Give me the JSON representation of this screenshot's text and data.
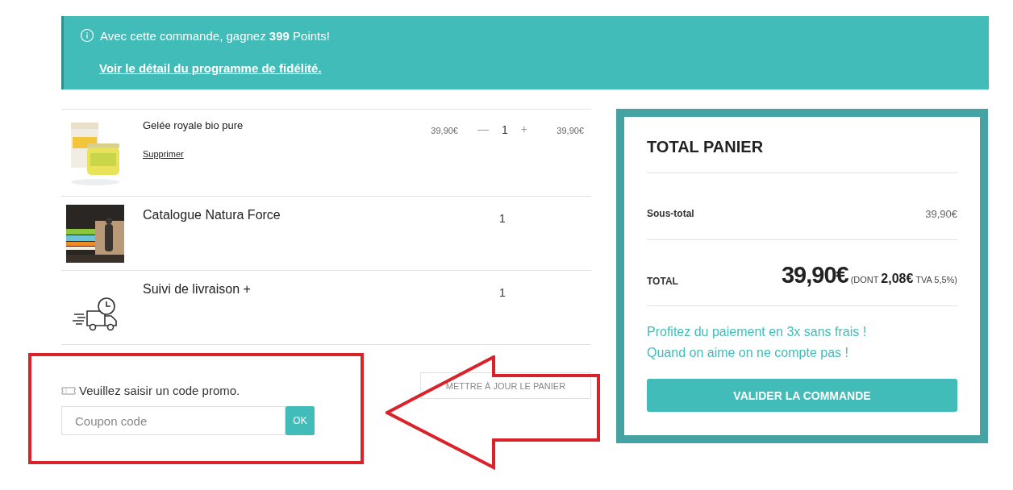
{
  "loyalty_banner": {
    "message": "Avec cette commande, gagnez **399** Points!",
    "link": "Voir le détail du programme de fidélité."
  },
  "cart_items": [
    {
      "kind": "picture",
      "name": "Gelée royale bio pure",
      "remove_link": "Supprimer",
      "unit_price": "39,90€",
      "decrease": "—",
      "quantity": "1",
      "increase": "+",
      "line_total": "39,90€"
    },
    {
      "kind": "picture",
      "name": "Catalogue Natura Force",
      "quantity": "1"
    },
    {
      "kind": "icon",
      "name": "Suivi de livraison +",
      "quantity": "1"
    }
  ],
  "promo": {
    "label": "Veuillez saisir un code promo.",
    "placeholder": "Coupon code",
    "apply_button": "OK"
  },
  "update_button": "METTRE À JOUR LE PANIER",
  "summary": {
    "title": "TOTAL PANIER",
    "subtotal_label": "Sous-total",
    "subtotal": "39,90€",
    "total_label": "TOTAL",
    "total": "39,90€",
    "tax_note": "(DONT **2,08€** TVA 5,5%)",
    "promo_lines": [
      "Profitez du paiement en 3x sans frais !",
      "Quand on aime on ne compte pas !"
    ],
    "checkout_button": "VALIDER LA COMMANDE"
  },
  "annotation": {
    "highlight_frame": true,
    "arrow": true
  }
}
